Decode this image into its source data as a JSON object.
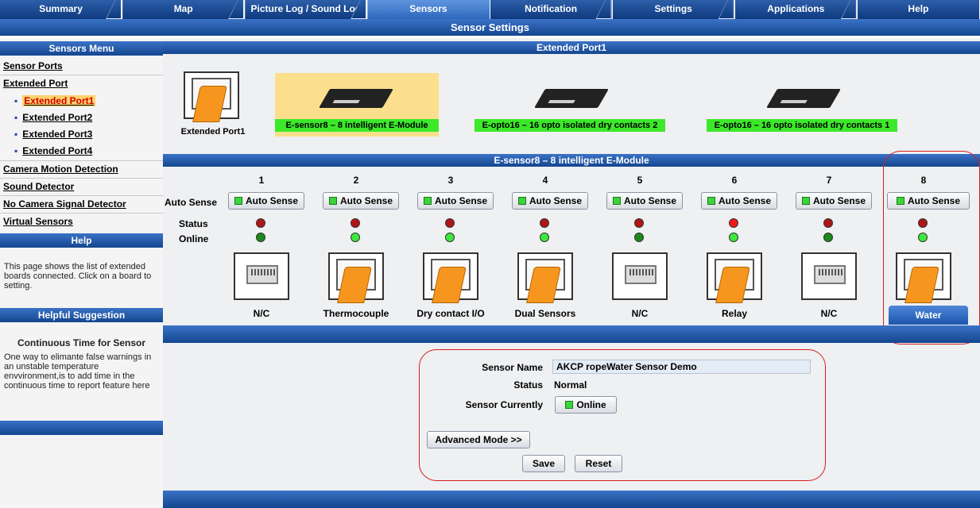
{
  "nav": {
    "tabs": [
      {
        "label": "Summary"
      },
      {
        "label": "Map"
      },
      {
        "label": "Picture Log / Sound Log"
      },
      {
        "label": "Sensors"
      },
      {
        "label": "Notification"
      },
      {
        "label": "Settings"
      },
      {
        "label": "Applications"
      },
      {
        "label": "Help"
      }
    ]
  },
  "page_title": "Sensor Settings",
  "sidebar": {
    "menu_header": "Sensors Menu",
    "items": [
      {
        "label": "Sensor Ports"
      },
      {
        "label": "Extended Port"
      },
      {
        "label": "Extended Port1"
      },
      {
        "label": "Extended Port2"
      },
      {
        "label": "Extended Port3"
      },
      {
        "label": "Extended Port4"
      },
      {
        "label": "Camera Motion Detection"
      },
      {
        "label": "Sound Detector"
      },
      {
        "label": "No Camera Signal Detector"
      },
      {
        "label": "Virtual Sensors"
      }
    ],
    "help_header": "Help",
    "help_text": "This page shows the list of extended boards connected. Click on a board to setting.",
    "suggest_header": "Helpful Suggestion",
    "suggest_title": "Continuous Time for Sensor",
    "suggest_text": "One way to elimante false warnings in an unstable temperature envvironment,is to add time in the continuous time to report feature here"
  },
  "ext_port": {
    "header": "Extended Port1",
    "port_label": "Extended Port1",
    "modules": [
      {
        "label": "E-sensor8 – 8 intelligent E-Module",
        "selected": true
      },
      {
        "label": "E-opto16 – 16 opto isolated dry contacts 2",
        "selected": false
      },
      {
        "label": "E-opto16 – 16 opto isolated dry contacts 1",
        "selected": false
      }
    ]
  },
  "module_grid": {
    "header": "E-sensor8 – 8 intelligent E-Module",
    "row_labels": {
      "auto_sense": "Auto Sense",
      "status": "Status",
      "online": "Online"
    },
    "button_label": "Auto Sense",
    "ports": [
      {
        "num": "1",
        "name": "N/C",
        "status_color": "#b01515",
        "online_color": "#1a8a1a",
        "connected": false
      },
      {
        "num": "2",
        "name": "Thermocouple",
        "status_color": "#b01515",
        "online_color": "#3ee83a",
        "connected": true
      },
      {
        "num": "3",
        "name": "Dry contact I/O",
        "status_color": "#b01515",
        "online_color": "#3ee83a",
        "connected": true
      },
      {
        "num": "4",
        "name": "Dual Sensors",
        "status_color": "#b01515",
        "online_color": "#3ee83a",
        "connected": true
      },
      {
        "num": "5",
        "name": "N/C",
        "status_color": "#b01515",
        "online_color": "#1a8a1a",
        "connected": false
      },
      {
        "num": "6",
        "name": "Relay",
        "status_color": "#f21818",
        "online_color": "#3ee83a",
        "connected": true
      },
      {
        "num": "7",
        "name": "N/C",
        "status_color": "#b01515",
        "online_color": "#1a8a1a",
        "connected": false
      },
      {
        "num": "8",
        "name": "Water",
        "status_color": "#b01515",
        "online_color": "#3ee83a",
        "connected": true,
        "selected": true
      }
    ]
  },
  "sensor_form": {
    "name_label": "Sensor Name",
    "name_value": "AKCP ropeWater Sensor Demo",
    "status_label": "Status",
    "status_value": "Normal",
    "currently_label": "Sensor Currently",
    "currently_value": "Online",
    "advanced_label": "Advanced Mode >>",
    "save_label": "Save",
    "reset_label": "Reset"
  },
  "colors": {
    "nav_blue": "#14468f",
    "active_tab": "#5f95df",
    "module_green": "#3ce82a",
    "selected_bg": "#fcdf8c",
    "highlight_ring": "#d51d1d"
  }
}
